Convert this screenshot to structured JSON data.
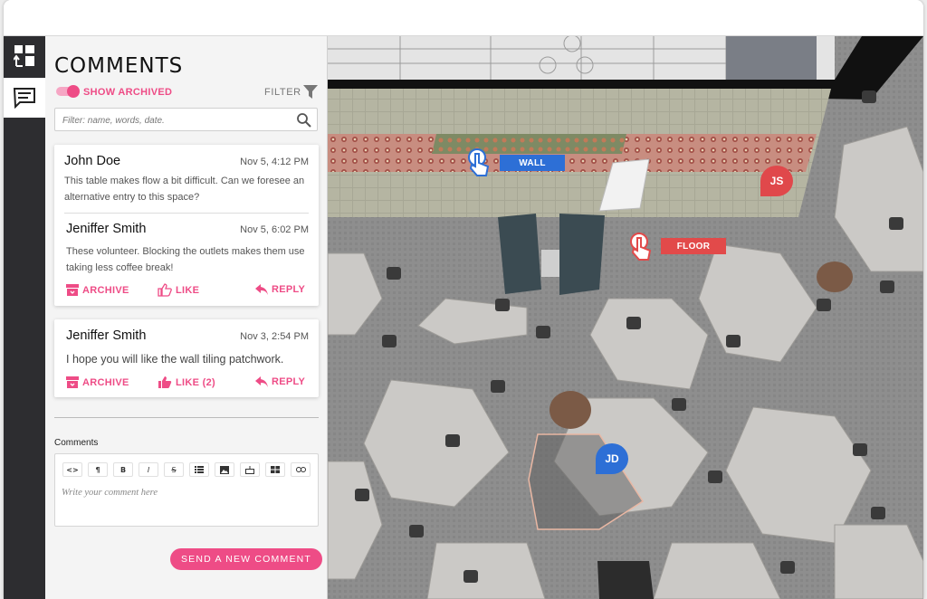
{
  "sidebar": {
    "tabs": [
      {
        "name": "dashboard",
        "icon": "dashboard-icon"
      },
      {
        "name": "comments",
        "icon": "comments-icon",
        "active": true
      }
    ]
  },
  "comments_panel": {
    "title": "COMMENTS",
    "show_archived_label": "SHOW ARCHIVED",
    "show_archived_on": true,
    "filter_label": "FILTER",
    "search_placeholder": "Filter: name, words, date.",
    "threads": [
      {
        "comments": [
          {
            "author": "John Doe",
            "date": "Nov 5, 4:12 PM",
            "text_line1": "This table makes flow a bit difficult. Can we foresee an",
            "text_line2": "alternative entry to this space?"
          },
          {
            "author": "Jeniffer Smith",
            "date": "Nov 5, 6:02 PM",
            "text_line1": "These volunteer. Blocking the outlets makes them use",
            "text_line2": "taking less coffee break!"
          }
        ],
        "actions": {
          "archive": "ARCHIVE",
          "like": "LIKE",
          "reply": "REPLY"
        }
      },
      {
        "comments": [
          {
            "author": "Jeniffer Smith",
            "date": "Nov 3, 2:54 PM",
            "text_line1": "I hope you will like the wall tiling patchwork."
          }
        ],
        "actions": {
          "archive": "ARCHIVE",
          "like": "LIKE (2)",
          "reply": "REPLY"
        }
      }
    ],
    "composer": {
      "label": "Comments",
      "toolbar": [
        "<>",
        "¶",
        "B",
        "I",
        "S",
        "list",
        "image",
        "embed",
        "table",
        "link"
      ],
      "placeholder": "Write your comment here",
      "send_label": "SEND A NEW COMMENT"
    }
  },
  "viewport": {
    "markers": [
      {
        "label": "WALL",
        "color": "#2d6fd6"
      },
      {
        "label": "FLOOR",
        "color": "#e24a4a"
      }
    ],
    "avatars": [
      {
        "initials": "JS",
        "color": "#e0484b"
      },
      {
        "initials": "JD",
        "color": "#2d6fd6"
      }
    ]
  },
  "colors": {
    "accent": "#ee4c86",
    "rail": "#2d2d30"
  }
}
